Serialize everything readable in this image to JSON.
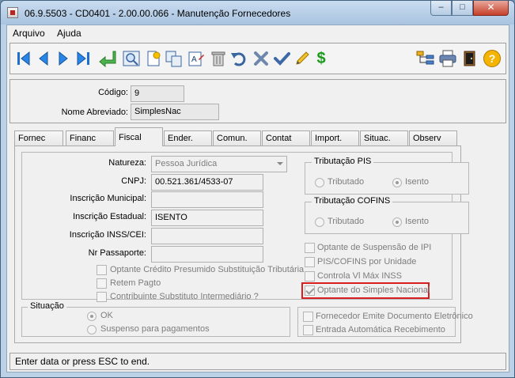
{
  "window": {
    "title": "06.9.5503 - CD0401 - 2.00.00.066 - Manutenção Fornecedores",
    "minimize_glyph": "–",
    "maximize_glyph": "□",
    "close_glyph": "✕"
  },
  "menu": {
    "items": [
      "Arquivo",
      "Ajuda"
    ]
  },
  "toolbar": {
    "icons": [
      "first-record-icon",
      "previous-record-icon",
      "next-record-icon",
      "last-record-icon",
      "return-icon",
      "search-icon",
      "new-record-icon",
      "copy-record-icon",
      "edit-record-icon",
      "delete-icon",
      "undo-icon",
      "cancel-icon",
      "confirm-icon",
      "pencil-icon",
      "dollar-icon",
      "tree-icon",
      "print-icon",
      "exit-icon",
      "help-icon"
    ],
    "dollar_glyph": "$",
    "help_glyph": "?"
  },
  "header": {
    "codigo_label": "Código:",
    "codigo_value": "9",
    "nome_label": "Nome Abreviado:",
    "nome_value": "SimplesNac"
  },
  "tabs": [
    {
      "label": "Fornec"
    },
    {
      "label": "Financ"
    },
    {
      "label": "Fiscal"
    },
    {
      "label": "Ender."
    },
    {
      "label": "Comun."
    },
    {
      "label": "Contat"
    },
    {
      "label": "Import."
    },
    {
      "label": "Situac."
    },
    {
      "label": "Observ"
    }
  ],
  "fiscal": {
    "natureza_label": "Natureza:",
    "natureza_value": "Pessoa Jurídica",
    "cnpj_label": "CNPJ:",
    "cnpj_value": "00.521.361/4533-07",
    "insc_municipal_label": "Inscrição Municipal:",
    "insc_municipal_value": "",
    "insc_estadual_label": "Inscrição Estadual:",
    "insc_estadual_value": "ISENTO",
    "insc_inss_label": "Inscrição INSS/CEI:",
    "insc_inss_value": "",
    "passaporte_label": "Nr Passaporte:",
    "passaporte_value": "",
    "chk_credito": "Optante Crédito Presumido Substituição Tributária",
    "chk_retem": "Retem Pagto",
    "chk_contribuinte": "Contribuinte Substituto Intermediário ?",
    "pis": {
      "title": "Tributação PIS",
      "opt1": "Tributado",
      "opt2": "Isento"
    },
    "cofins": {
      "title": "Tributação COFINS",
      "opt1": "Tributado",
      "opt2": "Isento"
    },
    "chk_suspensao_ipi": "Optante de Suspensão de IPI",
    "chk_pis_cofins_unidade": "PIS/COFINS por Unidade",
    "chk_controla_vl": "Controla Vl Máx INSS",
    "chk_simples": "Optante do Simples Nacional",
    "situacao": {
      "title": "Situação",
      "opt1": "OK",
      "opt2": "Suspenso para pagamentos"
    },
    "chk_emite_doc": "Fornecedor Emite Documento Eletrônico",
    "chk_entrada_auto": "Entrada Automática Recebimento"
  },
  "status": {
    "text": "Enter data or press ESC to end."
  }
}
